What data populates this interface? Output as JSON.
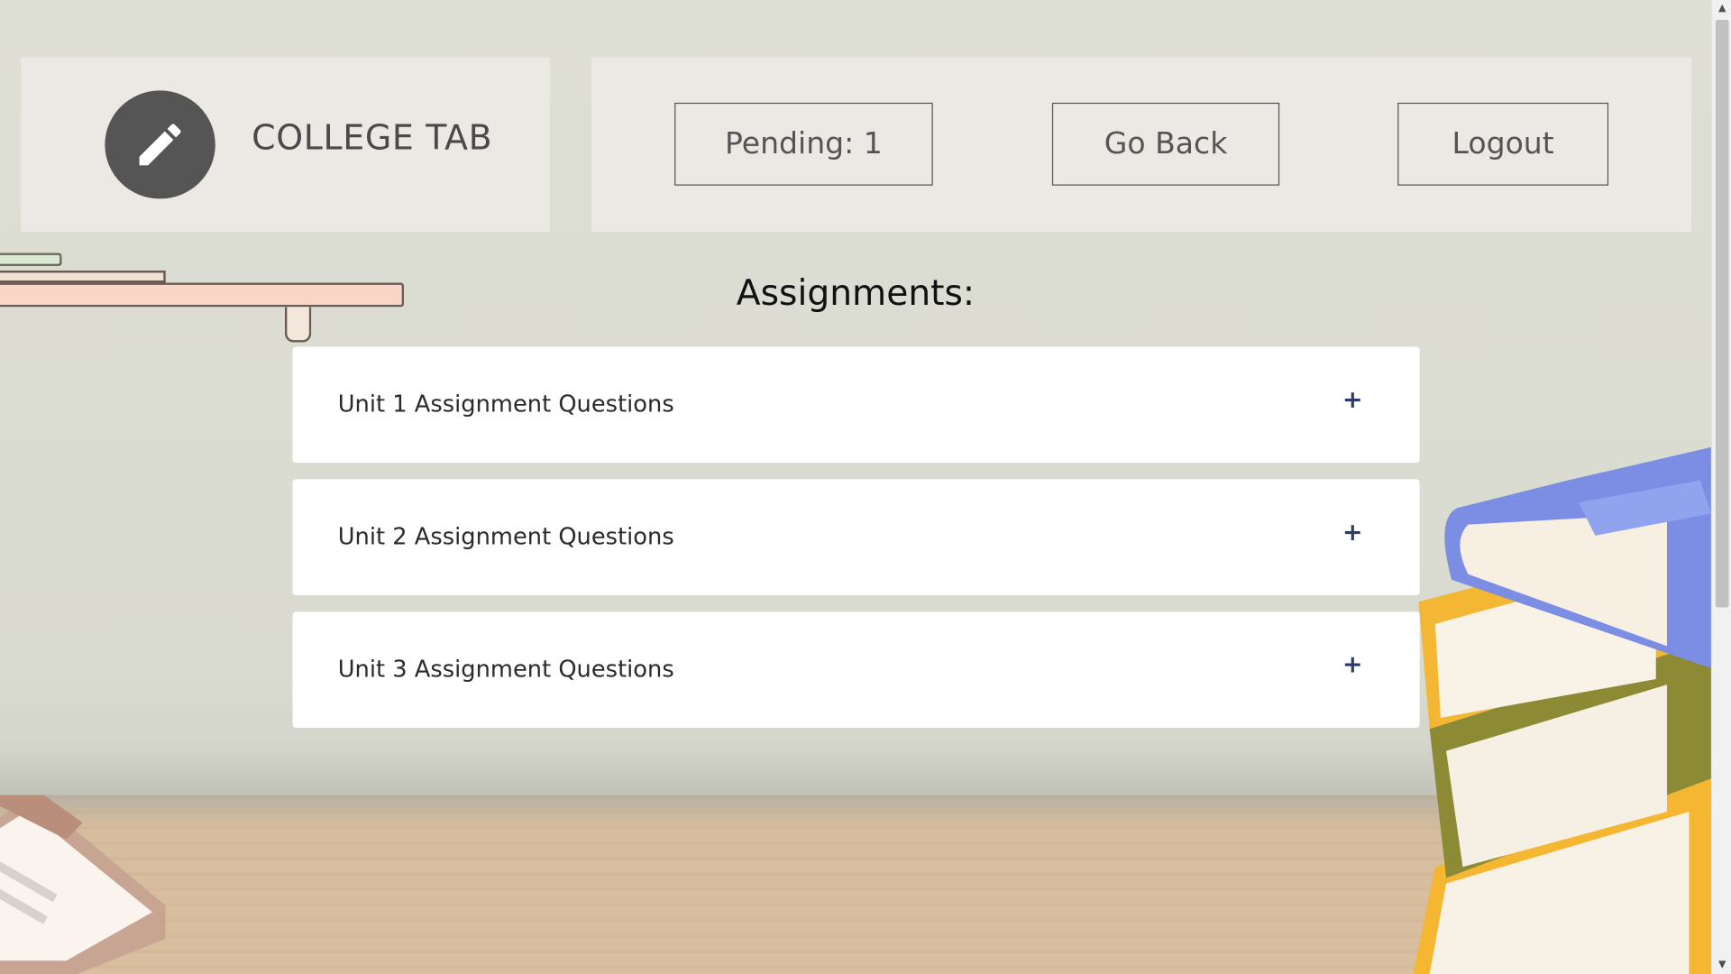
{
  "brand": {
    "title": "COLLEGE TAB",
    "icon": "pencil-icon"
  },
  "nav": {
    "pending_label": "Pending: 1",
    "back_label": "Go Back",
    "logout_label": "Logout"
  },
  "main": {
    "title": "Assignments:",
    "items": [
      {
        "label": "Unit 1 Assignment Questions",
        "toggle": "+"
      },
      {
        "label": "Unit 2 Assignment Questions",
        "toggle": "+"
      },
      {
        "label": "Unit 3 Assignment Questions",
        "toggle": "+"
      }
    ]
  },
  "colors": {
    "panel": "#ece9e4",
    "icon_circle": "#555555",
    "plus": "#2e3a6e",
    "wall": "#dedfd4"
  }
}
